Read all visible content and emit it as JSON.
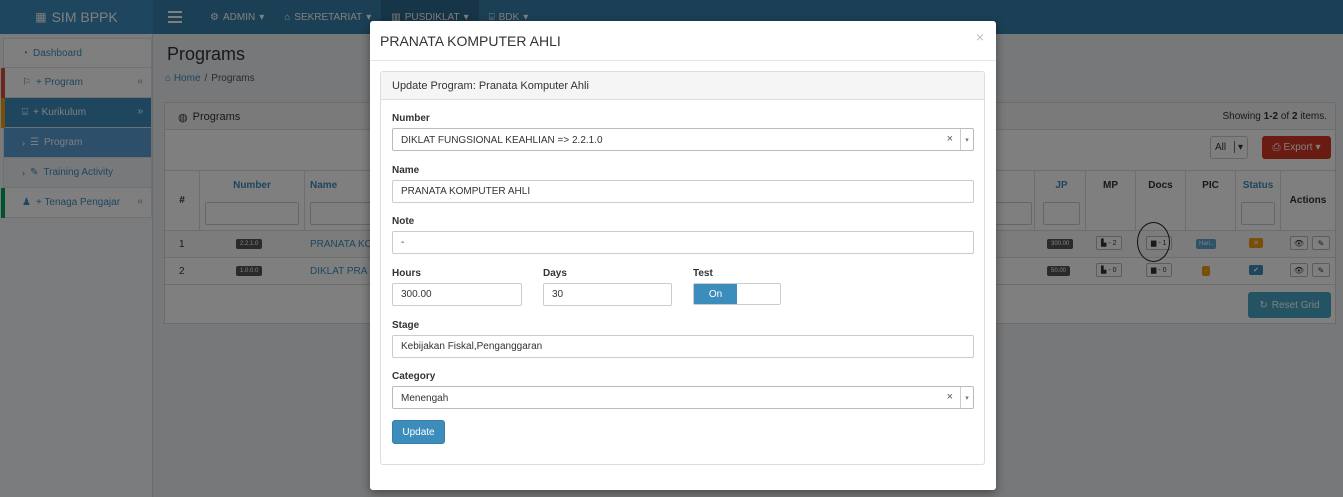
{
  "topbar": {
    "brand": "SIM BPPK",
    "menus": [
      {
        "label": "ADMIN",
        "icon": "gear-icon"
      },
      {
        "label": "SEKRETARIAT",
        "icon": "home-icon"
      },
      {
        "label": "PUSDIKLAT",
        "icon": "building-icon"
      },
      {
        "label": "BDK",
        "icon": "bank-icon"
      }
    ]
  },
  "sidebar": {
    "items": [
      {
        "label": "Dashboard",
        "icon": "dashboard-icon"
      },
      {
        "label": "+ Program",
        "icon": "flag-icon",
        "accent": "#dd4b39"
      },
      {
        "label": "+ Kurikulum",
        "icon": "bank-icon",
        "accent": "#f39c12"
      },
      {
        "label": "Program",
        "icon": "list-icon"
      },
      {
        "label": "Training Activity",
        "icon": "pencil-icon"
      },
      {
        "label": "+ Tenaga Pengajar",
        "icon": "users-icon",
        "accent": "#00a65a"
      }
    ]
  },
  "page": {
    "title": "Programs",
    "breadcrumb": [
      "Home",
      "/",
      "Programs"
    ]
  },
  "grid": {
    "title": "Programs",
    "summary_prefix": "Showing ",
    "summary_range": "1-2",
    "summary_of": " of ",
    "summary_total": "2",
    "summary_suffix": " items.",
    "filter_all": "All",
    "export": "Export",
    "reset": "Reset Grid",
    "columns": {
      "index": "#",
      "number": "Number",
      "name": "Name",
      "jp": "JP",
      "mp": "MP",
      "docs": "Docs",
      "pic": "PIC",
      "status": "Status",
      "actions": "Actions"
    },
    "rows": [
      {
        "num": "1",
        "code": "2.2.1.0",
        "name": "PRANATA KO",
        "jp": "300.00",
        "mp": "- 2",
        "docs": "- 1",
        "pic": "Hari..",
        "status": "✕",
        "status_color": "#f39c12"
      },
      {
        "num": "2",
        "code": "1.0.0.0",
        "name": "DIKLAT PRA",
        "jp": "50.00",
        "mp": "- 0",
        "docs": "- 0",
        "pic": "-",
        "status": "✔",
        "status_color": "#3c8dbc"
      }
    ]
  },
  "modal": {
    "title": "PRANATA KOMPUTER AHLI",
    "close": "×",
    "panel_title": "Update Program: Pranata Komputer Ahli",
    "fields": {
      "number_label": "Number",
      "number_value": "DIKLAT FUNGSIONAL KEAHLIAN => 2.2.1.0",
      "name_label": "Name",
      "name_value": "PRANATA KOMPUTER AHLI",
      "note_label": "Note",
      "note_value": "-",
      "hours_label": "Hours",
      "hours_value": "300.00",
      "days_label": "Days",
      "days_value": "30",
      "test_label": "Test",
      "test_value": "On",
      "stage_label": "Stage",
      "stage_value": "Kebijakan Fiskal,Penganggaran",
      "category_label": "Category",
      "category_value": "Menengah"
    },
    "clear": "×",
    "submit": "Update"
  },
  "colors": {
    "brand": "#3c8dbc",
    "navbar": "#367fa9",
    "export": "#d73925",
    "reset": "#48a7c6"
  }
}
